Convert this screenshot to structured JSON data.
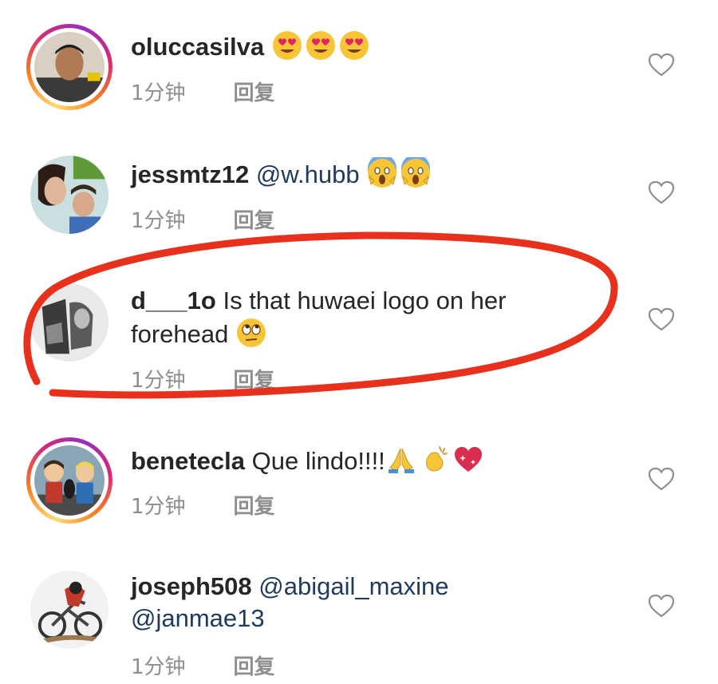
{
  "comments": [
    {
      "username": "oluccasilva",
      "text": "",
      "text2": "",
      "emojis": [
        "heart-eyes",
        "heart-eyes",
        "heart-eyes"
      ],
      "time": "1分钟",
      "reply": "回复",
      "story_ring": true
    },
    {
      "username": "jessmtz12",
      "mention": "@w.hubb",
      "emojis": [
        "scream",
        "scream"
      ],
      "time": "1分钟",
      "reply": "回复",
      "story_ring": false
    },
    {
      "username": "d___1o",
      "text": "Is that huwaei logo on her",
      "text2": "forehead",
      "emojis": [
        "eye-roll"
      ],
      "time": "1分钟",
      "reply": "回复",
      "story_ring": false
    },
    {
      "username": "benetecla",
      "text": "Que lindo!!!!",
      "emojis": [
        "folded-hands",
        "clapping",
        "sparkling-heart"
      ],
      "time": "1分钟",
      "reply": "回复",
      "story_ring": true
    },
    {
      "username": "joseph508",
      "mention": "@abigail_maxine",
      "mention2": "@janmae13",
      "time": "1分钟",
      "reply": "回复",
      "story_ring": false
    }
  ],
  "colors": {
    "highlight_stroke": "#e8311c",
    "meta_text": "#8e8e8e",
    "mention_text": "#1f3a5f"
  }
}
